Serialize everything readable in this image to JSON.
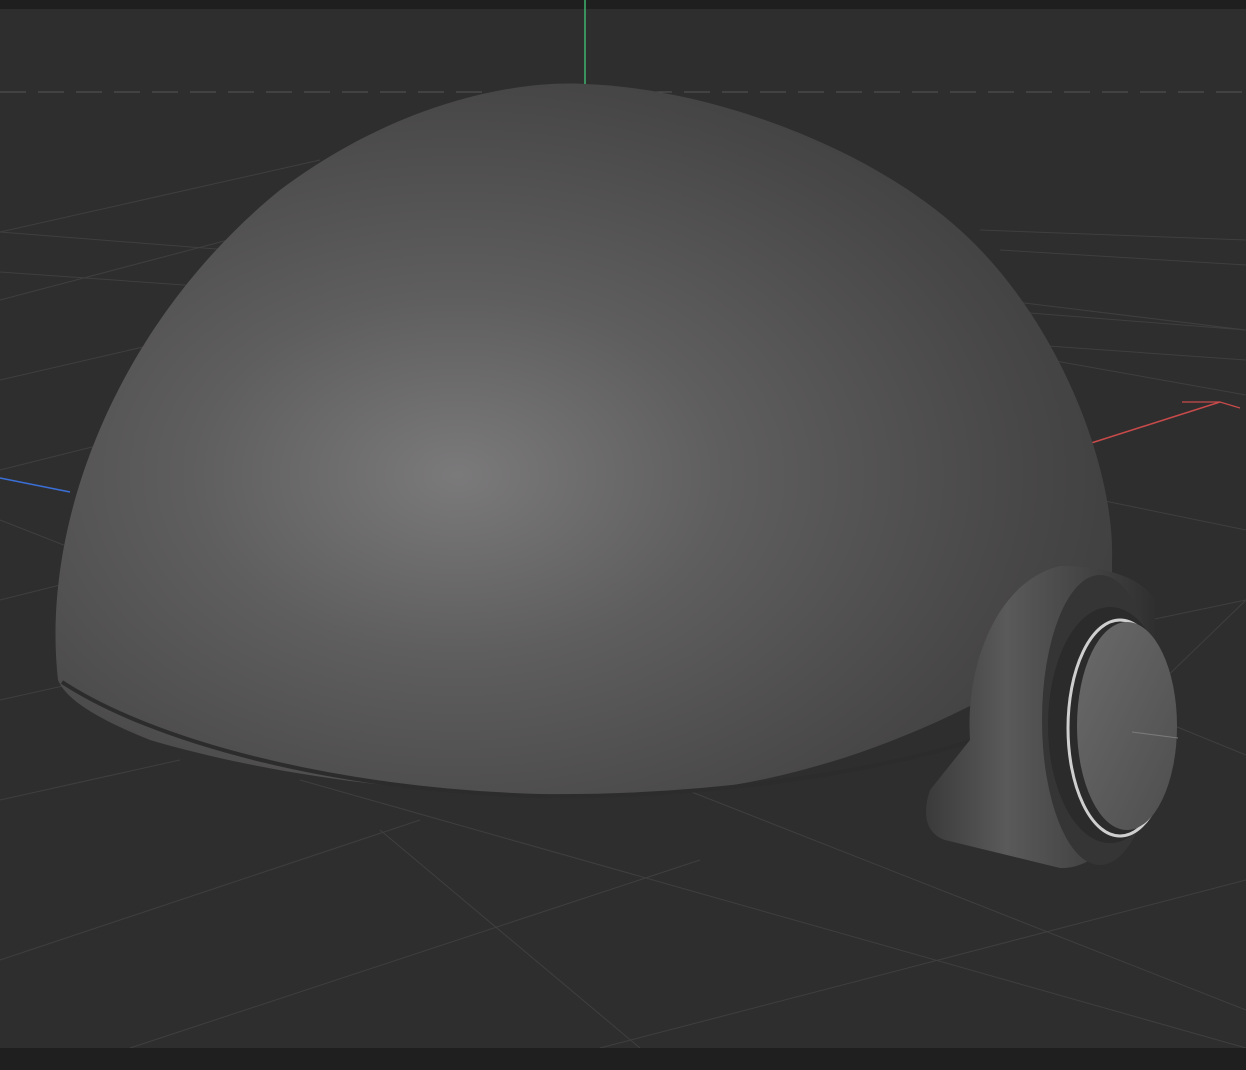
{
  "viewport": {
    "background_color": "#2e2e2e",
    "grid_color": "#3f3f3f",
    "axis_x_color": "#c84a4a",
    "axis_y_color": "#3fb56f",
    "axis_z_color": "#3b6fd6",
    "bar_color": "#1f1f1f"
  },
  "objects": {
    "dome_color": "#5a5959",
    "cylinder_color": "#4a4a4a",
    "cap_color": "#5e5e5e",
    "rim_highlight_color": "#cfcfcf"
  }
}
